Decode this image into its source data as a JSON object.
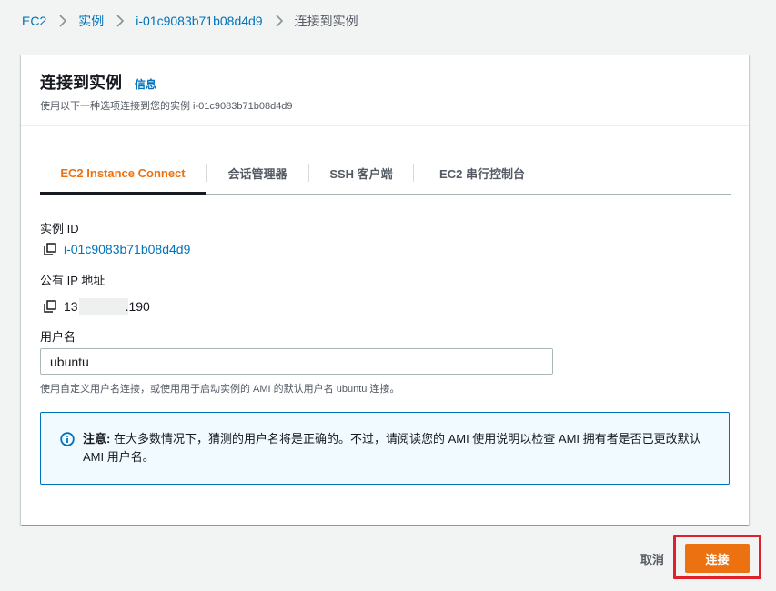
{
  "breadcrumb": {
    "items": [
      "EC2",
      "实例",
      "i-01c9083b71b08d4d9"
    ],
    "current": "连接到实例"
  },
  "panel": {
    "title": "连接到实例",
    "info_link": "信息",
    "description": "使用以下一种选项连接到您的实例 i-01c9083b71b08d4d9"
  },
  "tabs": [
    {
      "label": "EC2 Instance Connect",
      "active": true
    },
    {
      "label": "会话管理器",
      "active": false
    },
    {
      "label": "SSH 客户端",
      "active": false
    },
    {
      "label": "EC2 串行控制台",
      "active": false
    }
  ],
  "instance_id": {
    "label": "实例 ID",
    "value": "i-01c9083b71b08d4d9",
    "icon": "copy-icon"
  },
  "public_ip": {
    "label": "公有 IP 地址",
    "value_prefix": "13",
    "value_suffix": ".190",
    "icon": "copy-icon"
  },
  "username": {
    "label": "用户名",
    "value": "ubuntu",
    "hint": "使用自定义用户名连接，或使用用于启动实例的 AMI 的默认用户名 ubuntu 连接。"
  },
  "alert": {
    "icon": "info-circle-icon",
    "strong": "注意:",
    "text": " 在大多数情况下，猜测的用户名将是正确的。不过，请阅读您的 AMI 使用说明以检查 AMI 拥有者是否已更改默认 AMI 用户名。"
  },
  "footer": {
    "cancel_label": "取消",
    "connect_label": "连接"
  },
  "colors": {
    "link": "#0073bb",
    "accent": "#ec7211",
    "highlight_outline": "#e0202a",
    "alert_border": "#0073bb",
    "alert_bg": "#f1faff"
  }
}
